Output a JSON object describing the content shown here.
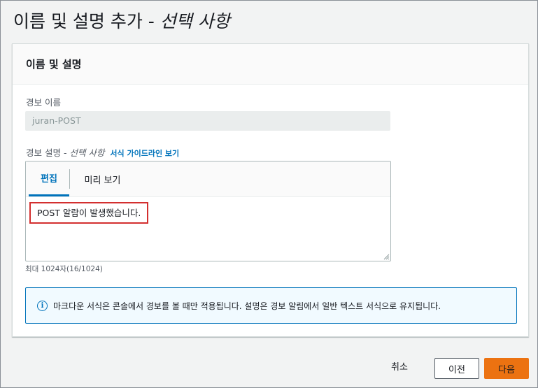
{
  "page": {
    "title_main": "이름 및 설명 추가 - ",
    "title_optional": "선택 사항"
  },
  "panel": {
    "header": "이름 및 설명",
    "alarm_name": {
      "label": "경보 이름",
      "value": "juran-POST"
    },
    "description": {
      "label": "경보 설명 - ",
      "label_optional": "선택 사항",
      "guide_link": "서식 가이드라인 보기",
      "tabs": [
        "편집",
        "미리 보기"
      ],
      "active_tab": "편집",
      "text": "POST 알람이 발생했습니다.",
      "char_count": "최대 1024자(16/1024)"
    },
    "info": {
      "icon": "info-icon",
      "text": "마크다운 서식은 콘솔에서 경보를 볼 때만 적용됩니다. 설명은 경보 알림에서 일반 텍스트 서식으로 유지됩니다."
    }
  },
  "footer": {
    "cancel": "취소",
    "previous": "이전",
    "next": "다음"
  },
  "colors": {
    "primary_button": "#ec7211",
    "link": "#0073bb",
    "highlight_border": "#d32f2f"
  }
}
